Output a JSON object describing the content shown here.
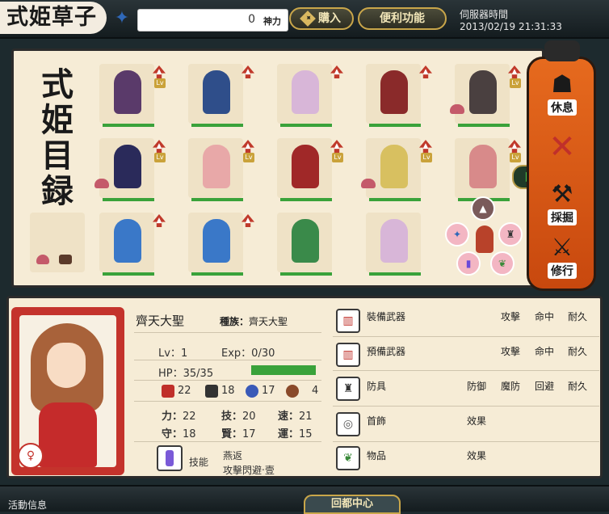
{
  "header": {
    "logo": "式姫草子",
    "points_value": "0",
    "points_unit": "神力",
    "buy_label": "購入",
    "util_label": "便利功能",
    "server_label": "伺服器時間",
    "server_time": "2013/02/19 21:31:33"
  },
  "catalog": {
    "title": "式姫目録"
  },
  "side_menu": {
    "rest": "休息",
    "dismiss_icon": "cross-icon",
    "gather": "採掘",
    "train": "修行"
  },
  "character": {
    "name": "齊天大聖",
    "race_label": "種族：",
    "race": "齊天大聖",
    "lv_label": "Lv：",
    "lv": "1",
    "exp_label": "Exp：",
    "exp": "0/30",
    "hp_label": "HP：",
    "hp": "35/35",
    "hp_fraction": 1.0,
    "atk": "22",
    "def": "18",
    "shield": "17",
    "food": "4",
    "str_label": "力：",
    "str": "22",
    "tec_label": "技：",
    "tec": "20",
    "spd_label": "速：",
    "spd": "21",
    "guard_label": "守：",
    "guard": "18",
    "wis_label": "賢：",
    "wis": "17",
    "luck_label": "運：",
    "luck": "15",
    "skill_label": "技能",
    "skill_name": "燕返",
    "skill_desc": "攻擊閃避‧壹"
  },
  "equipment": {
    "weapon": "裝備武器",
    "spare_weapon": "預備武器",
    "armor": "防具",
    "accessory": "首飾",
    "item": "物品",
    "attack": "攻擊",
    "hit": "命中",
    "durability": "耐久",
    "defense": "防御",
    "magic_def": "魔防",
    "evade": "回避",
    "effect": "效果"
  },
  "footer": {
    "activity": "活動信息",
    "guild": "回都中心"
  },
  "colors": {
    "accent_orange": "#e66a1e",
    "hp_green": "#3aa23a",
    "card_red": "#c4332c"
  }
}
